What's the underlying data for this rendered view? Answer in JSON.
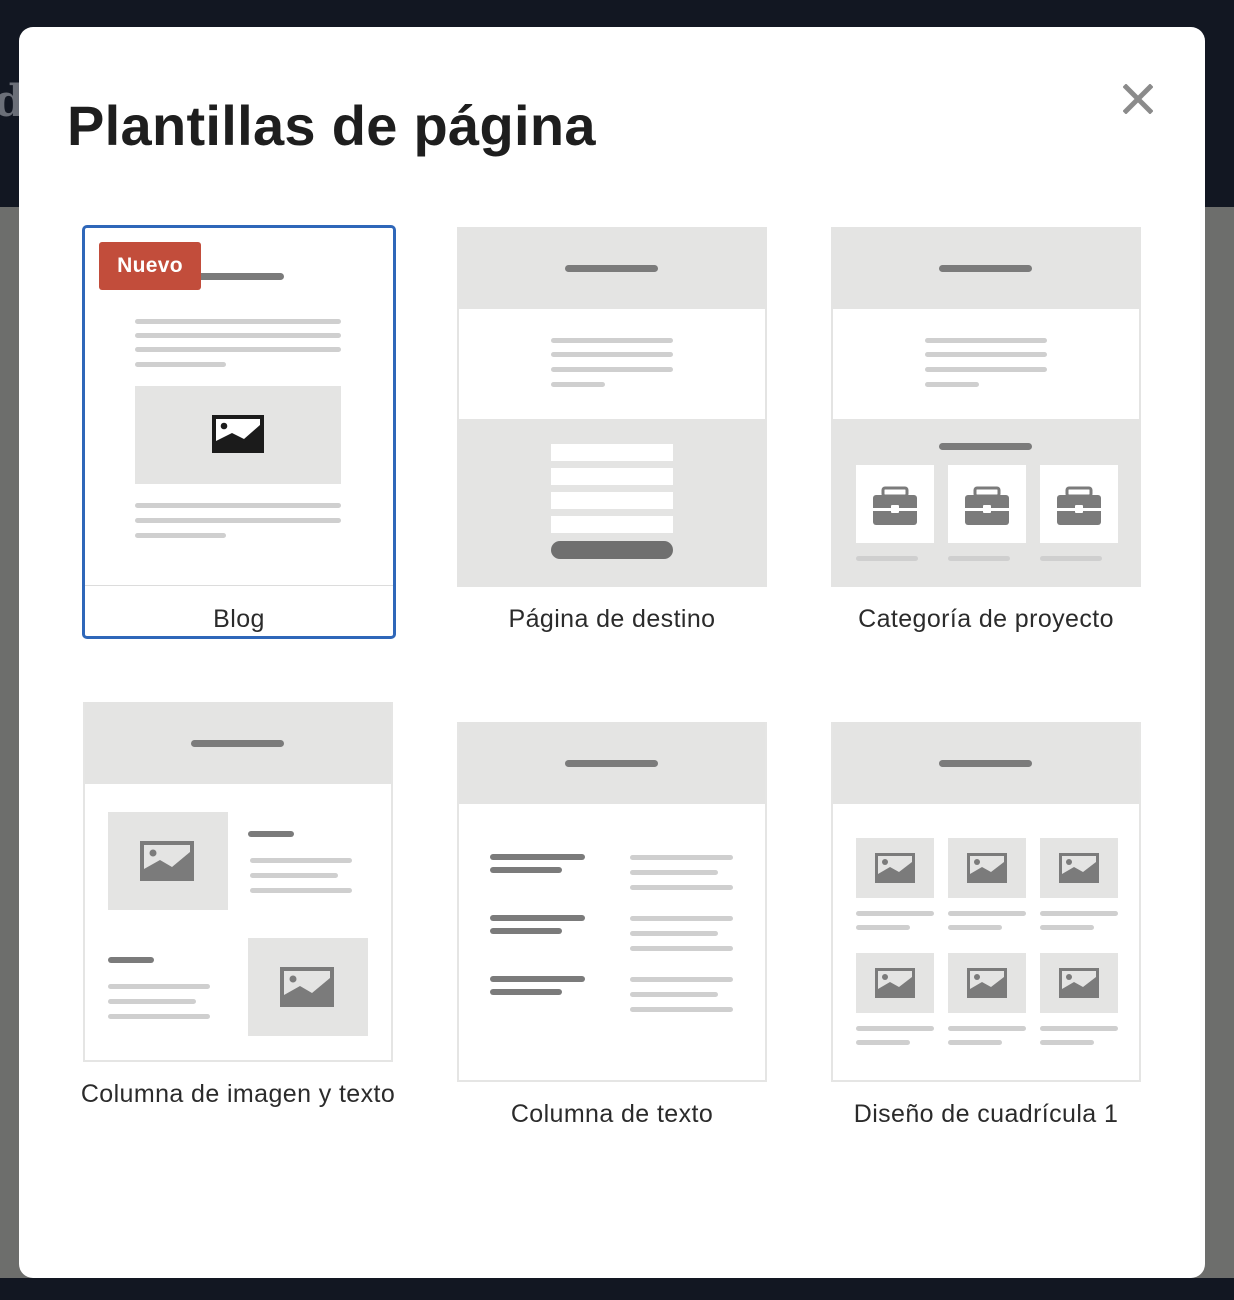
{
  "modal": {
    "title": "Plantillas de página",
    "close_icon": "close-icon"
  },
  "templates": [
    {
      "label": "Blog",
      "badge": "Nuevo",
      "selected": true
    },
    {
      "label": "Página de destino",
      "selected": false
    },
    {
      "label": "Categoría de proyecto",
      "selected": false
    },
    {
      "label": "Columna de imagen y texto",
      "selected": false
    },
    {
      "label": "Columna de texto",
      "selected": false
    },
    {
      "label": "Diseño de cuadrícula 1",
      "selected": false
    }
  ],
  "colors": {
    "selected_border": "#2f67b9",
    "badge_bg": "#c24d3b",
    "placeholder_fill": "#e4e4e3",
    "placeholder_line_dark": "#7b7b7b",
    "placeholder_line_light": "#cfcfcf"
  }
}
